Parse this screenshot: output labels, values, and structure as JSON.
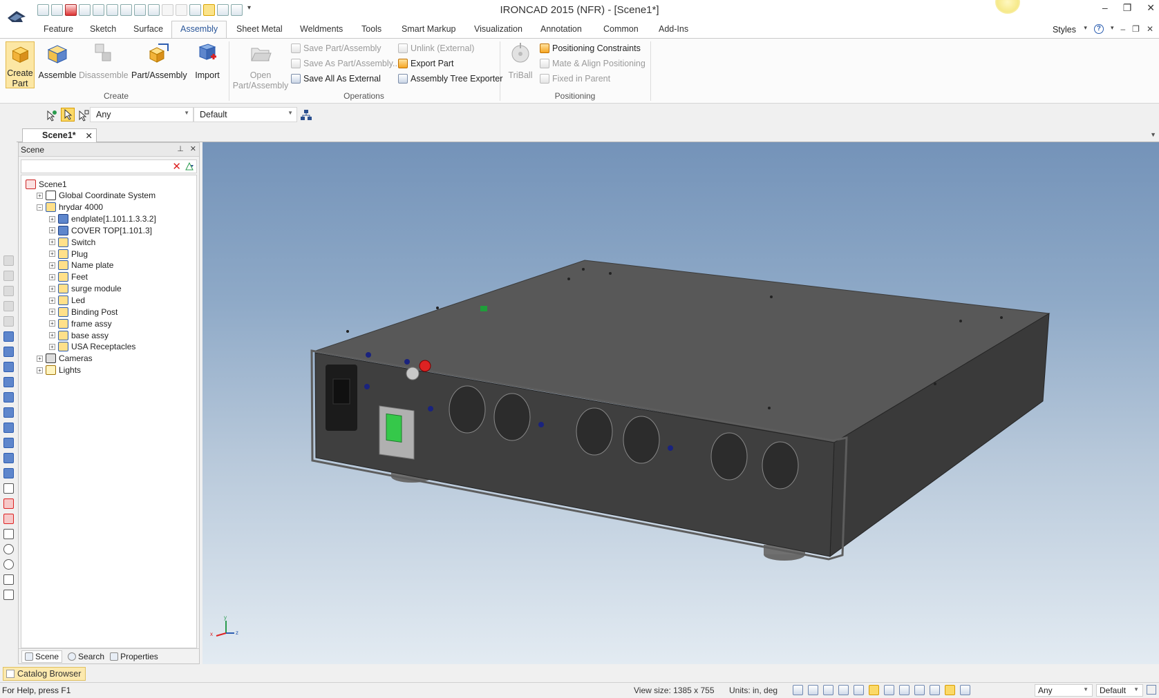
{
  "window": {
    "title": "IRONCAD 2015 (NFR) - [Scene1*]",
    "controls": [
      "–",
      "❐",
      "✕"
    ]
  },
  "ribbon_tabs": [
    "Feature",
    "Sketch",
    "Surface",
    "Assembly",
    "Sheet Metal",
    "Weldments",
    "Tools",
    "Smart Markup",
    "Visualization",
    "Annotation",
    "Common",
    "Add-Ins"
  ],
  "active_tab": "Assembly",
  "styles_label": "Styles",
  "ribbon": {
    "create": {
      "label": "Create",
      "create_part": "Create Part",
      "assemble": "Assemble",
      "disassemble": "Disassemble",
      "part_assembly": "Part/Assembly",
      "import": "Import"
    },
    "operations": {
      "label": "Operations",
      "open": "Open Part/Assembly",
      "save_part": "Save Part/Assembly",
      "save_as_part": "Save As Part/Assembly...",
      "save_all_external": "Save All As External",
      "unlink": "Unlink (External)",
      "export_part": "Export Part",
      "tree_exporter": "Assembly Tree Exporter"
    },
    "positioning": {
      "label": "Positioning",
      "triball": "TriBall",
      "constraints": "Positioning Constraints",
      "mate_align": "Mate & Align Positioning",
      "fixed": "Fixed in Parent"
    }
  },
  "selection_toolbar": {
    "filter": "Any",
    "style": "Default"
  },
  "document_tab": {
    "name": "Scene1*",
    "close": "✕"
  },
  "scene_panel": {
    "title": "Scene",
    "tree": [
      {
        "label": "Scene1",
        "icon": "scene-icon",
        "depth": 0,
        "expander": ""
      },
      {
        "label": "Global Coordinate System",
        "icon": "coordinate-system-icon",
        "depth": 1,
        "expander": "+"
      },
      {
        "label": "hrydar 4000",
        "icon": "assembly-icon",
        "depth": 1,
        "expander": "−"
      },
      {
        "label": "endplate[1.101.1.3.3.2]",
        "icon": "part-icon",
        "depth": 2,
        "expander": "+"
      },
      {
        "label": "COVER TOP[1.101.3]",
        "icon": "part-icon",
        "depth": 2,
        "expander": "+"
      },
      {
        "label": "Switch",
        "icon": "assembly-icon",
        "depth": 2,
        "expander": "+"
      },
      {
        "label": "Plug",
        "icon": "assembly-icon",
        "depth": 2,
        "expander": "+"
      },
      {
        "label": "Name plate",
        "icon": "assembly-icon",
        "depth": 2,
        "expander": "+"
      },
      {
        "label": "Feet",
        "icon": "assembly-icon",
        "depth": 2,
        "expander": "+"
      },
      {
        "label": "surge module",
        "icon": "assembly-icon",
        "depth": 2,
        "expander": "+"
      },
      {
        "label": "Led",
        "icon": "assembly-icon",
        "depth": 2,
        "expander": "+"
      },
      {
        "label": "Binding Post",
        "icon": "assembly-icon",
        "depth": 2,
        "expander": "+"
      },
      {
        "label": "frame assy",
        "icon": "assembly-icon",
        "depth": 2,
        "expander": "+"
      },
      {
        "label": "base assy",
        "icon": "assembly-icon",
        "depth": 2,
        "expander": "+"
      },
      {
        "label": "USA Receptacles",
        "icon": "assembly-icon",
        "depth": 2,
        "expander": "+"
      },
      {
        "label": "Cameras",
        "icon": "camera-icon",
        "depth": 1,
        "expander": "+"
      },
      {
        "label": "Lights",
        "icon": "light-icon",
        "depth": 1,
        "expander": "+"
      }
    ],
    "footer_tabs": [
      "Scene",
      "Search",
      "Properties"
    ]
  },
  "catalog_browser": "Catalog Browser",
  "status": {
    "help": "For Help, press F1",
    "view_size": "View size: 1385 x  755",
    "units": "Units: in, deg",
    "filter": "Any",
    "style": "Default"
  },
  "triad": {
    "x": "x",
    "y": "y",
    "z": "z"
  },
  "colors": {
    "accent": "#2b579a",
    "highlight": "#fce7a4",
    "viewport_top": "#7493b9",
    "viewport_bottom": "#e3ebf2",
    "switch_green": "#35c84a"
  }
}
